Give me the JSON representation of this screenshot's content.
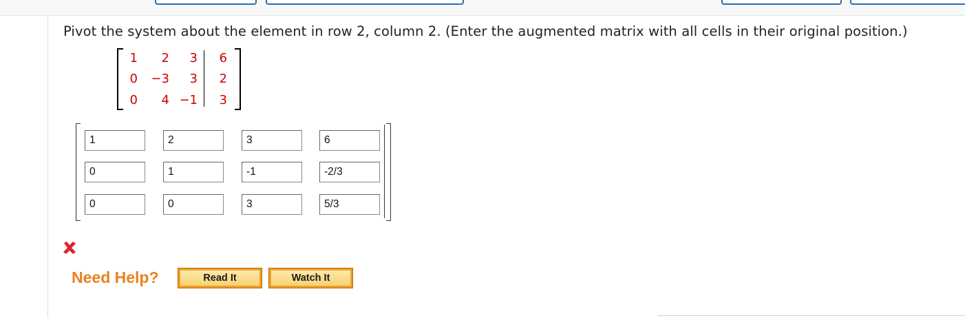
{
  "question": {
    "prompt": "Pivot the system about the element in row 2, column 2. (Enter the augmented matrix with all cells in their original position.)"
  },
  "given_matrix": {
    "rows": [
      [
        "1",
        "2",
        "3",
        "6"
      ],
      [
        "0",
        "−3",
        "3",
        "2"
      ],
      [
        "0",
        "4",
        "−1",
        "3"
      ]
    ],
    "color": "#cc0000"
  },
  "answer_matrix": {
    "rows": [
      [
        "1",
        "2",
        "3",
        "6"
      ],
      [
        "0",
        "1",
        "-1",
        "-2/3"
      ],
      [
        "0",
        "0",
        "3",
        "5/3"
      ]
    ]
  },
  "feedback": {
    "status": "incorrect",
    "icon": "cross-icon",
    "color": "#d9262c"
  },
  "help": {
    "label": "Need Help?",
    "read_button": "Read It",
    "watch_button": "Watch It",
    "accent": "#e8821c"
  }
}
